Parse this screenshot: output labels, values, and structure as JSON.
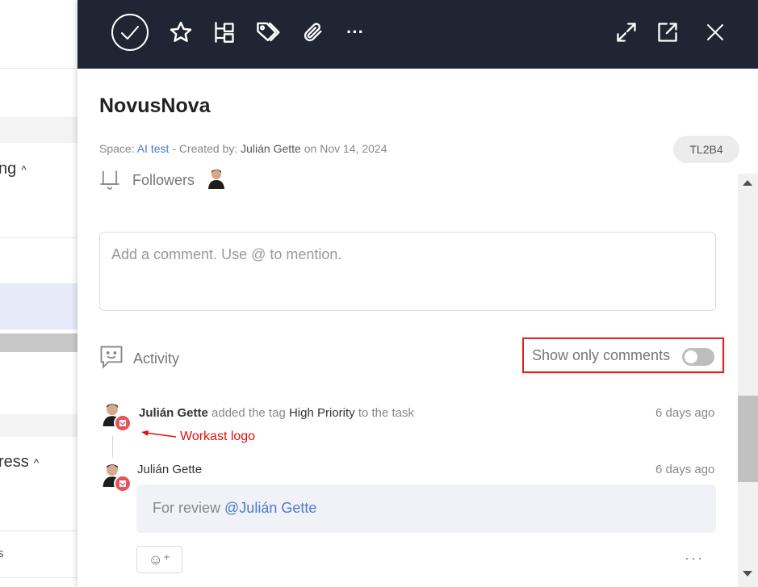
{
  "background": {
    "groups": [
      {
        "label": "ng",
        "chevron": "^"
      },
      {
        "label": "ress",
        "chevron": "^"
      }
    ],
    "row_fragment": "s"
  },
  "toolbar": {
    "icons": [
      "check-circle-icon",
      "star-icon",
      "subtask-icon",
      "tag-icon",
      "paperclip-icon",
      "more-icon",
      "expand-icon",
      "open-external-icon",
      "close-icon"
    ],
    "more_label": "···"
  },
  "task": {
    "title": "NovusNova",
    "space_label": "Space:",
    "space_name": "AI test",
    "created_by_label": "- Created by:",
    "creator": "Julián Gette",
    "on_label": "on",
    "date": "Nov 14, 2024",
    "id": "TL2B4"
  },
  "followers": {
    "label": "Followers"
  },
  "comment": {
    "placeholder": "Add a comment. Use @ to mention."
  },
  "activity": {
    "label": "Activity",
    "show_only_comments_label": "Show only comments",
    "show_only_comments": false,
    "entries": [
      {
        "user": "Julián Gette",
        "action_pre": "added the tag",
        "tag": "High Priority",
        "action_post": "to the task",
        "time": "6 days ago"
      },
      {
        "user": "Julián Gette",
        "time": "6 days ago",
        "comment_text": "For review",
        "mention": "@Julián Gette"
      }
    ],
    "annotation": "Workast logo",
    "react_label": "☺⁺",
    "more_label": "···"
  },
  "colors": {
    "toolbar_bg": "#1f2533",
    "link": "#4a7bd0",
    "badge": "#e8525a",
    "annotation": "#e01010"
  }
}
